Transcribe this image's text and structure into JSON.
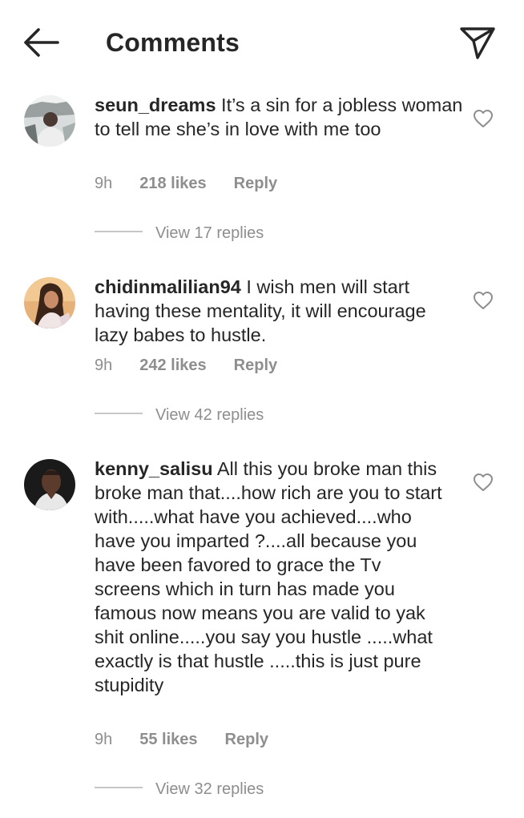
{
  "header": {
    "title": "Comments",
    "back_icon": "back-arrow-icon",
    "send_icon": "paper-plane-icon"
  },
  "comments": [
    {
      "username": "seun_dreams",
      "text": " It’s a sin for a jobless woman to tell me she’s in love with me too",
      "time": "9h",
      "likes": "218 likes",
      "reply_label": "Reply",
      "view_replies": "View 17 replies",
      "avatar": "avatar-man-in-car"
    },
    {
      "username": "chidinmalilian94",
      "text": " I wish men will start having these mentality, it will encourage lazy babes to hustle.",
      "time": "9h",
      "likes": "242 likes",
      "reply_label": "Reply",
      "view_replies": "View 42 replies",
      "avatar": "avatar-woman-portrait"
    },
    {
      "username": "kenny_salisu",
      "text": " All this you broke man this broke man that....how rich are you to start with.....what have you achieved....who have you imparted ?....all because you have been favored to grace the Tv screens which in turn has made you famous now means you are valid to yak shit online.....you say you hustle .....what exactly is that hustle .....this is just pure stupidity",
      "time": "9h",
      "likes": "55 likes",
      "reply_label": "Reply",
      "view_replies": "View 32 replies",
      "avatar": "avatar-man-dark-background"
    }
  ],
  "colors": {
    "text_primary": "#262626",
    "text_secondary": "#8e8e8e",
    "divider": "#c7c7c7",
    "background": "#ffffff"
  }
}
